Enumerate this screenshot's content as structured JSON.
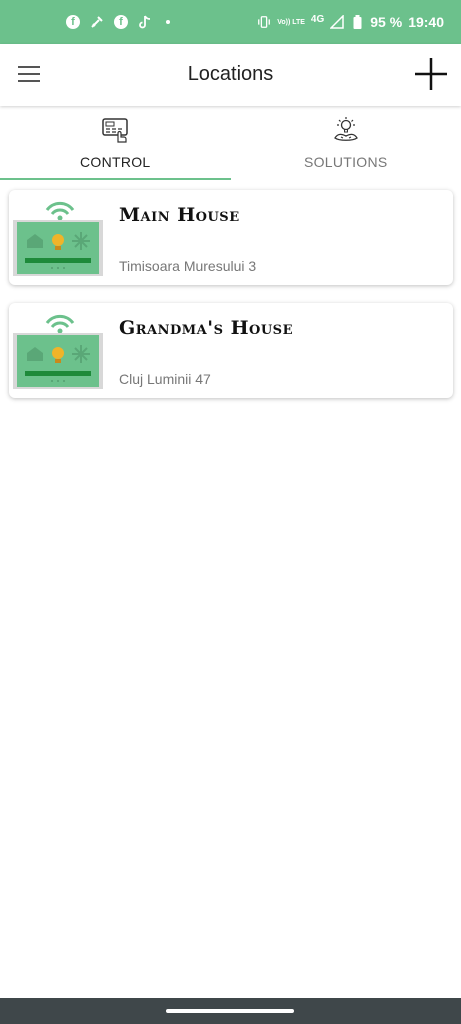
{
  "status_bar": {
    "network_small": "Vo)) LTE",
    "network": "4G",
    "battery": "95 %",
    "time": "19:40"
  },
  "app_bar": {
    "title": "Locations"
  },
  "tabs": [
    {
      "label": "CONTROL",
      "icon": "control-panel-icon",
      "active": true
    },
    {
      "label": "SOLUTIONS",
      "icon": "solutions-bulb-icon",
      "active": false
    }
  ],
  "locations": [
    {
      "name": "Main House",
      "address": "Timisoara Muresului 3"
    },
    {
      "name": "Grandma's House",
      "address": "Cluj Luminii 47"
    }
  ],
  "colors": {
    "accent": "#6cc18c",
    "nav_bar": "#3f474a"
  }
}
